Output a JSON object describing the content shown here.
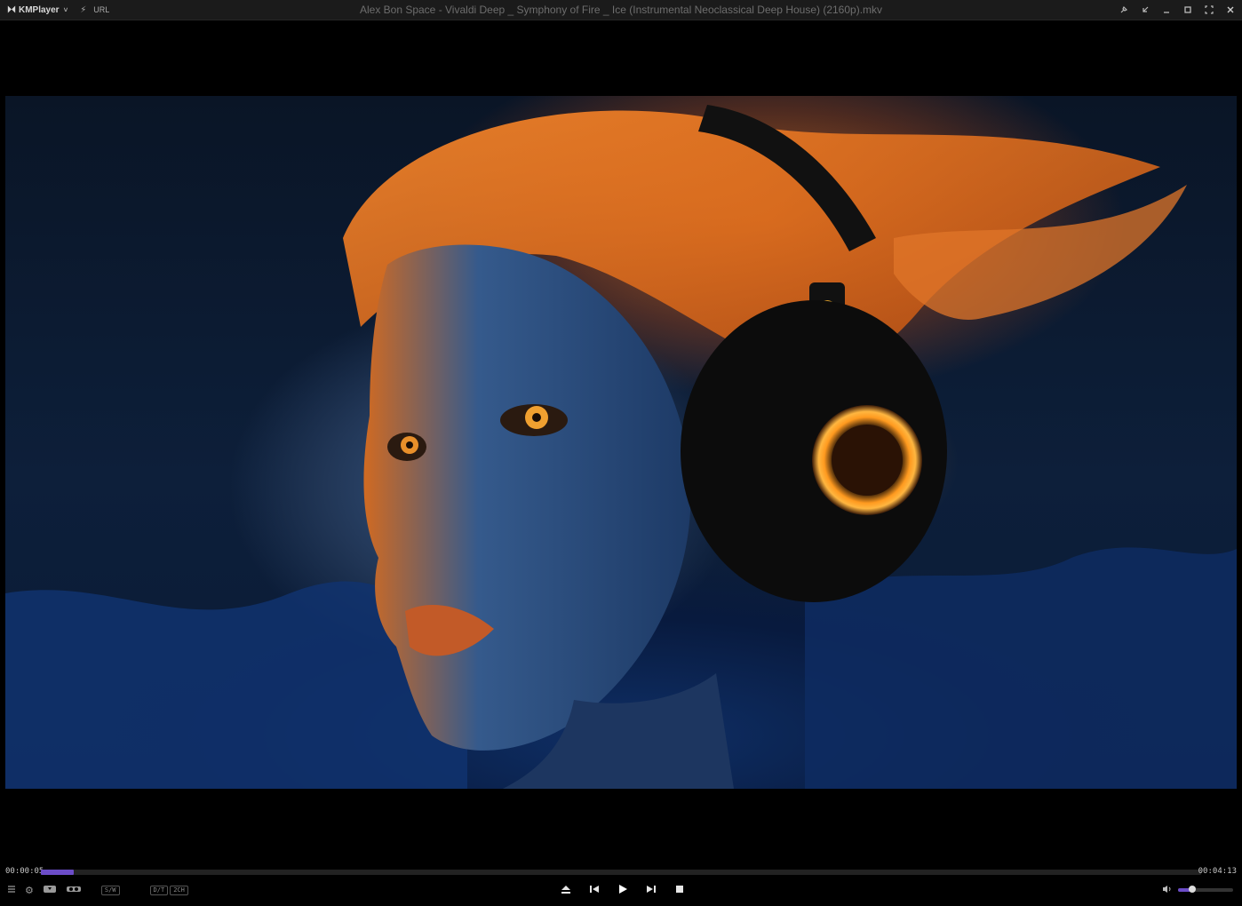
{
  "app": {
    "logo_mark": "⏵⏴",
    "logo": "KMPlayer",
    "logo_caret": "˅",
    "url_label": "URL",
    "title": "Alex Bon Space - Vivaldi Deep _ Symphony of Fire _ Ice (Instrumental Neoclassical Deep House) (2160p).mkv"
  },
  "window_buttons": [
    "pin-icon",
    "shrink-icon",
    "minimize-icon",
    "maximize-icon",
    "fullscreen-icon",
    "close-icon"
  ],
  "playback": {
    "current_time": "00:00:05",
    "total_time": "00:04:13",
    "progress_fraction": 0.028,
    "volume_fraction": 0.25
  },
  "chips": {
    "sw": "S/W",
    "dt": "D/T",
    "ch": "2CH"
  },
  "colors": {
    "accent": "#6b4cc7",
    "titlebar": "#1b1b1b"
  }
}
